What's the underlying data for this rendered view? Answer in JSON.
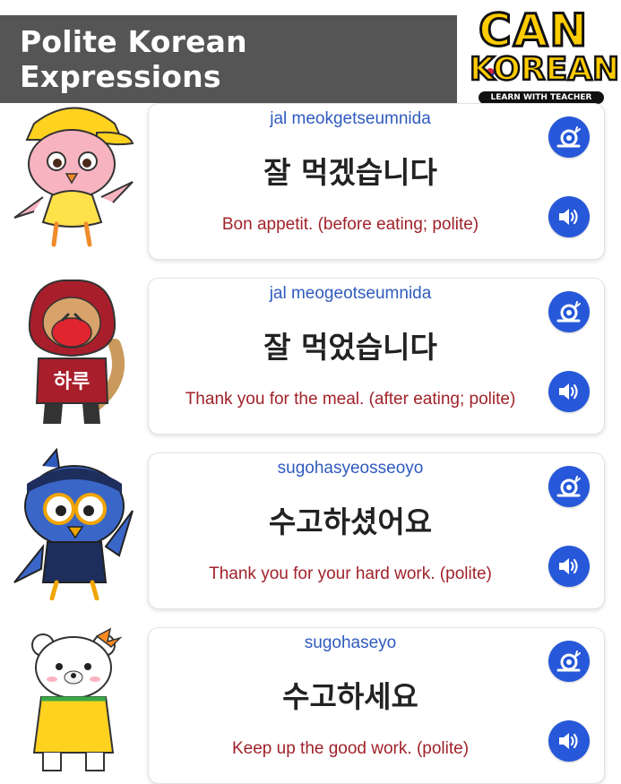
{
  "header": {
    "title": "Polite Korean Expressions"
  },
  "logo": {
    "line1": "CAN",
    "line2": "KOREAN",
    "tagline": "LEARN WITH TEACHER"
  },
  "cards": [
    {
      "romanization": "jal meokgetseumnida",
      "hangul": "잘 먹겠습니다",
      "meaning": "Bon appetit. (before eating; polite)",
      "mascot": "chick-mascot"
    },
    {
      "romanization": "jal meogeotseumnida",
      "hangul": "잘 먹었습니다",
      "meaning": "Thank you for the meal. (after eating; polite)",
      "mascot": "fox-mascot",
      "mascot_text": "하루"
    },
    {
      "romanization": "sugohasyeosseoyo",
      "hangul": "수고하셨어요",
      "meaning": "Thank you for your hard work. (polite)",
      "mascot": "bird-mascot"
    },
    {
      "romanization": "sugohaseyo",
      "hangul": "수고하세요",
      "meaning": "Keep up the good work. (polite)",
      "mascot": "bear-mascot"
    }
  ],
  "colors": {
    "header_bg": "#555555",
    "button_blue": "#2758d9",
    "romanization": "#2f5bbf",
    "meaning": "#a0222a"
  },
  "icons": {
    "slow": "snail-icon",
    "play": "speaker-icon"
  }
}
